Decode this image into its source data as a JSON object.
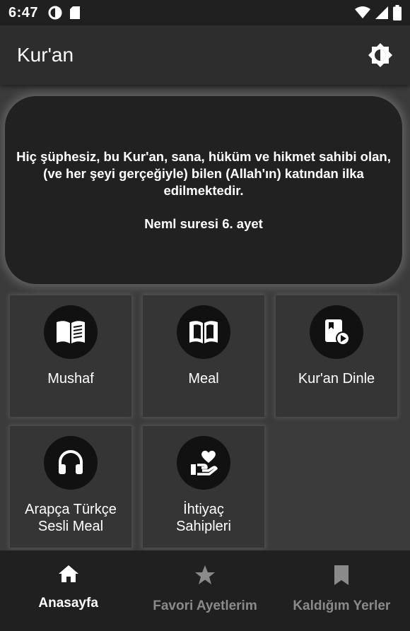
{
  "status_bar": {
    "time": "6:47"
  },
  "app_bar": {
    "title": "Kur'an",
    "theme_icon": "brightness-icon"
  },
  "verse_card": {
    "text": "Hiç şüphesiz, bu Kur'an, sana, hüküm ve hikmet sahibi olan, (ve her şeyi gerçeğiyle) bilen (Allah'ın) katından ilka edilmektedir.",
    "reference": "Neml suresi 6. ayet"
  },
  "tiles": [
    {
      "label": "Mushaf",
      "icon": "book-open-text-icon"
    },
    {
      "label": "Meal",
      "icon": "book-open-icon"
    },
    {
      "label": "Kur'an Dinle",
      "icon": "play-book-icon"
    },
    {
      "label": "Arapça Türkçe\nSesli Meal",
      "icon": "headphones-icon"
    },
    {
      "label": "İhtiyaç\nSahipleri",
      "icon": "heart-hand-icon"
    }
  ],
  "bottom_nav": [
    {
      "label": "Anasayfa",
      "icon": "home-icon",
      "active": true
    },
    {
      "label": "Favori Ayetlerim",
      "icon": "star-icon",
      "active": false
    },
    {
      "label": "Kaldığım Yerler",
      "icon": "bookmark-icon",
      "active": false
    }
  ],
  "colors": {
    "background": "#3b3b3b",
    "appbar": "#2d2d2d",
    "card": "#212121",
    "tile": "#353535",
    "nav": "#202020"
  }
}
